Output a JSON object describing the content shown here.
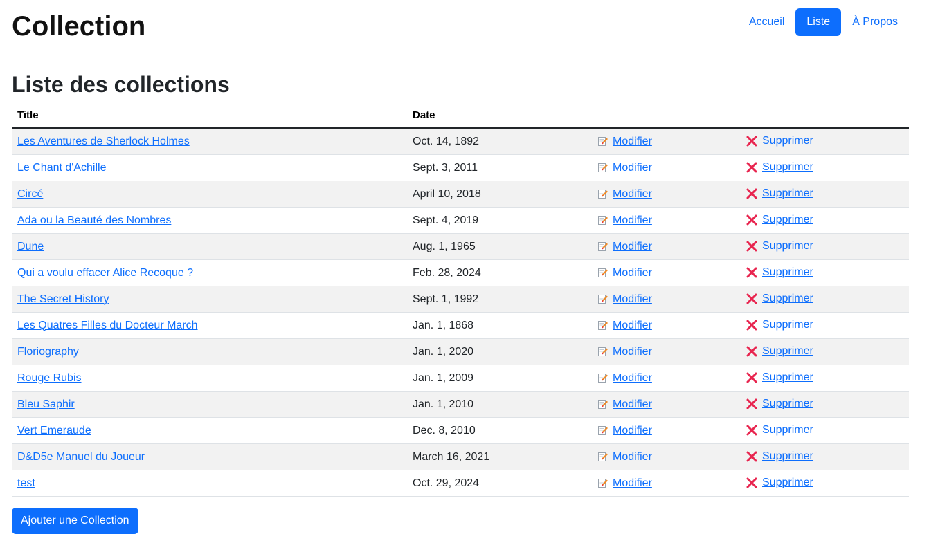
{
  "header": {
    "brand": "Collection",
    "nav": [
      {
        "label": "Accueil",
        "active": false
      },
      {
        "label": "Liste",
        "active": true
      },
      {
        "label": "À Propos",
        "active": false
      }
    ]
  },
  "main": {
    "title": "Liste des collections",
    "table": {
      "columns": [
        "Title",
        "Date",
        "",
        ""
      ],
      "edit_label": "Modifier",
      "delete_label": "Supprimer",
      "rows": [
        {
          "title": "Les Aventures de Sherlock Holmes",
          "date": "Oct. 14, 1892"
        },
        {
          "title": "Le Chant d'Achille",
          "date": "Sept. 3, 2011"
        },
        {
          "title": "Circé",
          "date": "April 10, 2018"
        },
        {
          "title": "Ada ou la Beauté des Nombres",
          "date": "Sept. 4, 2019"
        },
        {
          "title": "Dune",
          "date": "Aug. 1, 1965"
        },
        {
          "title": "Qui a voulu effacer Alice Recoque ?",
          "date": "Feb. 28, 2024"
        },
        {
          "title": "The Secret History",
          "date": "Sept. 1, 1992"
        },
        {
          "title": "Les Quatres Filles du Docteur March",
          "date": "Jan. 1, 1868"
        },
        {
          "title": "Floriography",
          "date": "Jan. 1, 2020"
        },
        {
          "title": "Rouge Rubis",
          "date": "Jan. 1, 2009"
        },
        {
          "title": "Bleu Saphir",
          "date": "Jan. 1, 2010"
        },
        {
          "title": "Vert Emeraude",
          "date": "Dec. 8, 2010"
        },
        {
          "title": "D&D5e Manuel du Joueur",
          "date": "March 16, 2021"
        },
        {
          "title": "test",
          "date": "Oct. 29, 2024"
        }
      ]
    },
    "add_button": "Ajouter une Collection"
  },
  "icons": {
    "edit": "pencil-edit-icon",
    "delete": "red-cross-icon"
  },
  "colors": {
    "primary": "#0d6efd",
    "delete_red": "#e8254f",
    "stripe": "#f2f2f2"
  }
}
